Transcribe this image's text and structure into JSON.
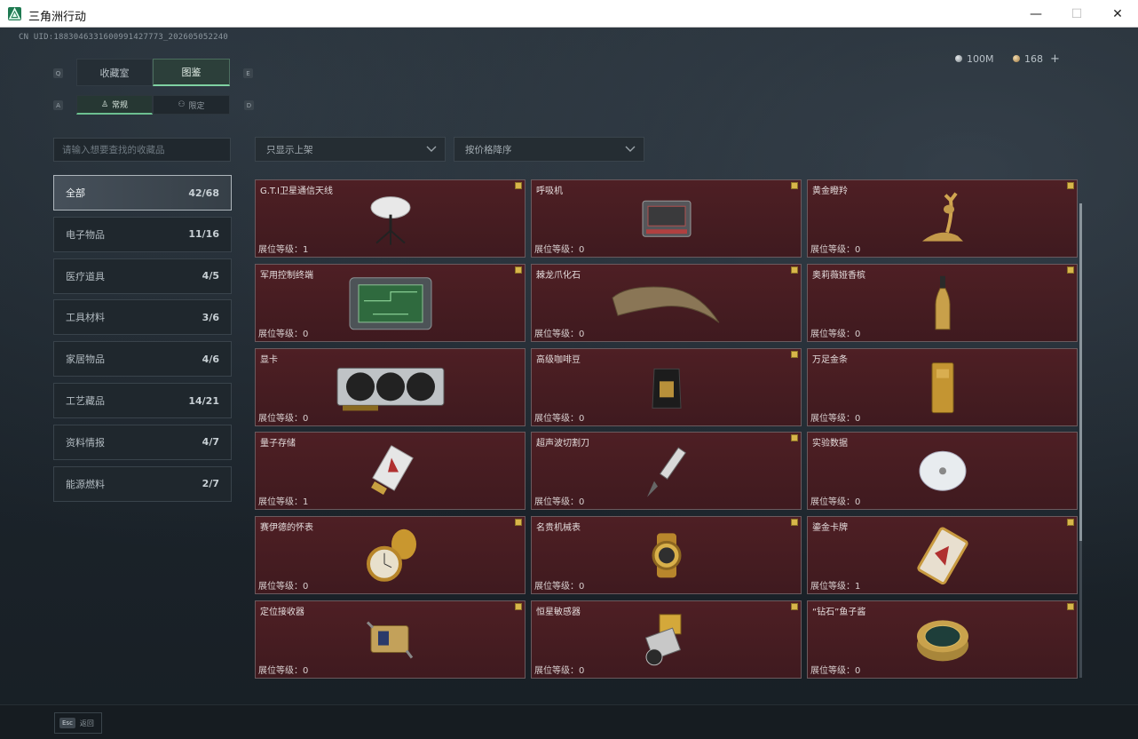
{
  "window": {
    "title": "三角洲行动",
    "min": "—",
    "max": "☐",
    "close": "✕"
  },
  "header": {
    "uid": "CN UID:1883046331600991427773_202605052240",
    "currency": [
      {
        "value": "100M",
        "color": "#9aa3a9"
      },
      {
        "value": "168",
        "color": "#c9a46a",
        "plus": "+"
      }
    ]
  },
  "tabs": {
    "key_left": "Q",
    "key_right": "E",
    "items": [
      {
        "label": "收藏室",
        "active": false
      },
      {
        "label": "图鉴",
        "active": true
      }
    ]
  },
  "subtabs": {
    "key_left": "A",
    "key_right": "D",
    "items": [
      {
        "label": "常规",
        "icon": "♙",
        "active": true
      },
      {
        "label": "限定",
        "icon": "⚇",
        "active": false
      }
    ]
  },
  "search": {
    "placeholder": "请输入想要查找的收藏品"
  },
  "filters": [
    {
      "label": "只显示上架"
    },
    {
      "label": "按价格降序"
    }
  ],
  "categories": [
    {
      "label": "全部",
      "count": "42/68",
      "active": true
    },
    {
      "label": "电子物品",
      "count": "11/16"
    },
    {
      "label": "医疗道具",
      "count": "4/5"
    },
    {
      "label": "工具材料",
      "count": "3/6"
    },
    {
      "label": "家居物品",
      "count": "4/6"
    },
    {
      "label": "工艺藏品",
      "count": "14/21"
    },
    {
      "label": "资料情报",
      "count": "4/7"
    },
    {
      "label": "能源燃料",
      "count": "2/7"
    }
  ],
  "items": [
    {
      "name": "G.T.I卫星通信天线",
      "level": "展位等级：1",
      "badge": true,
      "icon": "satellite-dish-icon"
    },
    {
      "name": "呼吸机",
      "level": "展位等级：0",
      "badge": true,
      "icon": "ventilator-icon"
    },
    {
      "name": "黄金瞪羚",
      "level": "展位等级：0",
      "badge": true,
      "icon": "golden-gazelle-icon"
    },
    {
      "name": "军用控制终端",
      "level": "展位等级：0",
      "badge": true,
      "icon": "control-terminal-icon"
    },
    {
      "name": "棘龙爪化石",
      "level": "展位等级：0",
      "badge": true,
      "icon": "claw-fossil-icon"
    },
    {
      "name": "奥莉薇娅香槟",
      "level": "展位等级：0",
      "badge": true,
      "icon": "champagne-icon"
    },
    {
      "name": "显卡",
      "level": "展位等级：0",
      "badge": false,
      "icon": "graphics-card-icon"
    },
    {
      "name": "高级咖啡豆",
      "level": "展位等级：0",
      "badge": true,
      "icon": "coffee-bag-icon"
    },
    {
      "name": "万足金条",
      "level": "展位等级：0",
      "badge": false,
      "icon": "gold-bar-icon"
    },
    {
      "name": "量子存储",
      "level": "展位等级：1",
      "badge": false,
      "icon": "quantum-storage-icon"
    },
    {
      "name": "超声波切割刀",
      "level": "展位等级：0",
      "badge": true,
      "icon": "ultrasonic-knife-icon"
    },
    {
      "name": "实验数据",
      "level": "展位等级：0",
      "badge": false,
      "icon": "data-disc-icon"
    },
    {
      "name": "赛伊德的怀表",
      "level": "展位等级：0",
      "badge": true,
      "icon": "pocket-watch-icon"
    },
    {
      "name": "名贵机械表",
      "level": "展位等级：0",
      "badge": true,
      "icon": "wristwatch-icon"
    },
    {
      "name": "鎏金卡牌",
      "level": "展位等级：1",
      "badge": true,
      "icon": "gilded-card-icon"
    },
    {
      "name": "定位接收器",
      "level": "展位等级：0",
      "badge": true,
      "icon": "gps-receiver-icon"
    },
    {
      "name": "恒星敏感器",
      "level": "展位等级：0",
      "badge": true,
      "icon": "star-sensor-icon"
    },
    {
      "name": "“钻石”鱼子酱",
      "level": "展位等级：0",
      "badge": true,
      "icon": "caviar-tin-icon"
    }
  ],
  "footer": {
    "key": "Esc",
    "label": "返回"
  },
  "colors": {
    "accent": "#7fd1a2",
    "card_bg": "#4e1f24",
    "badge": "#d8b64a"
  }
}
